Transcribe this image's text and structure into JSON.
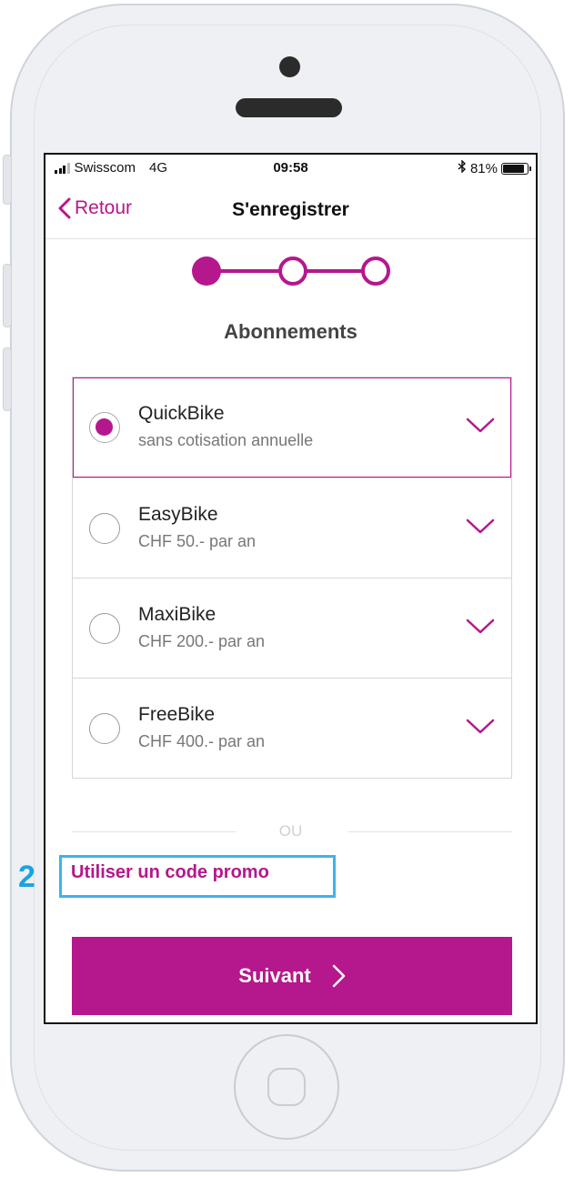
{
  "status_bar": {
    "carrier": "Swisscom",
    "network": "4G",
    "time": "09:58",
    "battery": "81%",
    "battery_level": 0.81
  },
  "navbar": {
    "back_label": "Retour",
    "title": "S'enregistrer"
  },
  "stepper": {
    "total_steps": 3,
    "current_step": 1,
    "step_title": "Abonnements"
  },
  "plans": [
    {
      "name": "QuickBike",
      "subtitle": "sans cotisation annuelle",
      "selected": true
    },
    {
      "name": "EasyBike",
      "subtitle": "CHF 50.- par an",
      "selected": false
    },
    {
      "name": "MaxiBike",
      "subtitle": "CHF 200.- par an",
      "selected": false
    },
    {
      "name": "FreeBike",
      "subtitle": "CHF 400.- par an",
      "selected": false
    }
  ],
  "separator_label": "OU",
  "promo_link": "Utiliser un code promo",
  "next_button": "Suivant",
  "annotation": {
    "number": "2"
  },
  "colors": {
    "accent": "#b5178d",
    "annotation": "#1aa3e3"
  }
}
